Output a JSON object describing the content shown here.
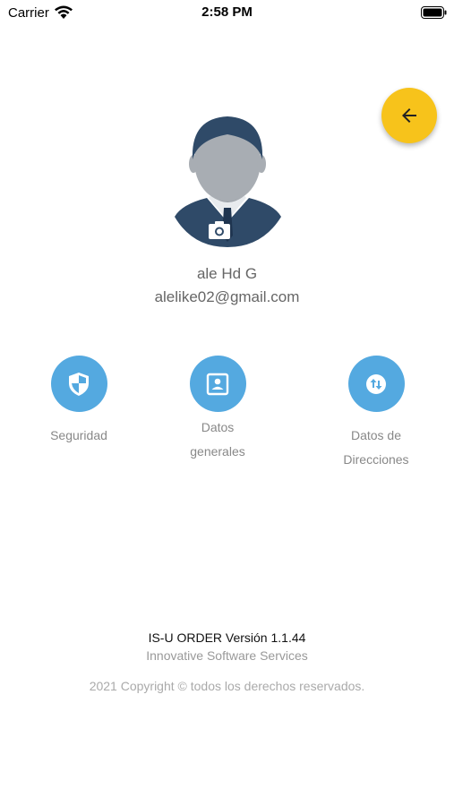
{
  "status_bar": {
    "carrier": "Carrier",
    "time": "2:58 PM"
  },
  "profile": {
    "name": "ale Hd G",
    "email": "alelike02@gmail.com"
  },
  "options": [
    {
      "label": "Seguridad",
      "icon": "shield-icon"
    },
    {
      "label_line1": "Datos",
      "label_line2": "generales",
      "icon": "contact-card-icon"
    },
    {
      "label_line1": "Datos de",
      "label_line2": "Direcciones",
      "icon": "swap-arrows-icon"
    }
  ],
  "footer": {
    "title": "IS-U ORDER Versión 1.1.44",
    "company": "Innovative Software Services",
    "copyright": "2021 Copyright © todos los derechos reservados."
  },
  "colors": {
    "accent_yellow": "#f7c31b",
    "option_blue": "#54a9e0",
    "avatar_dark": "#2f4a68",
    "avatar_skin": "#a8adb3"
  }
}
